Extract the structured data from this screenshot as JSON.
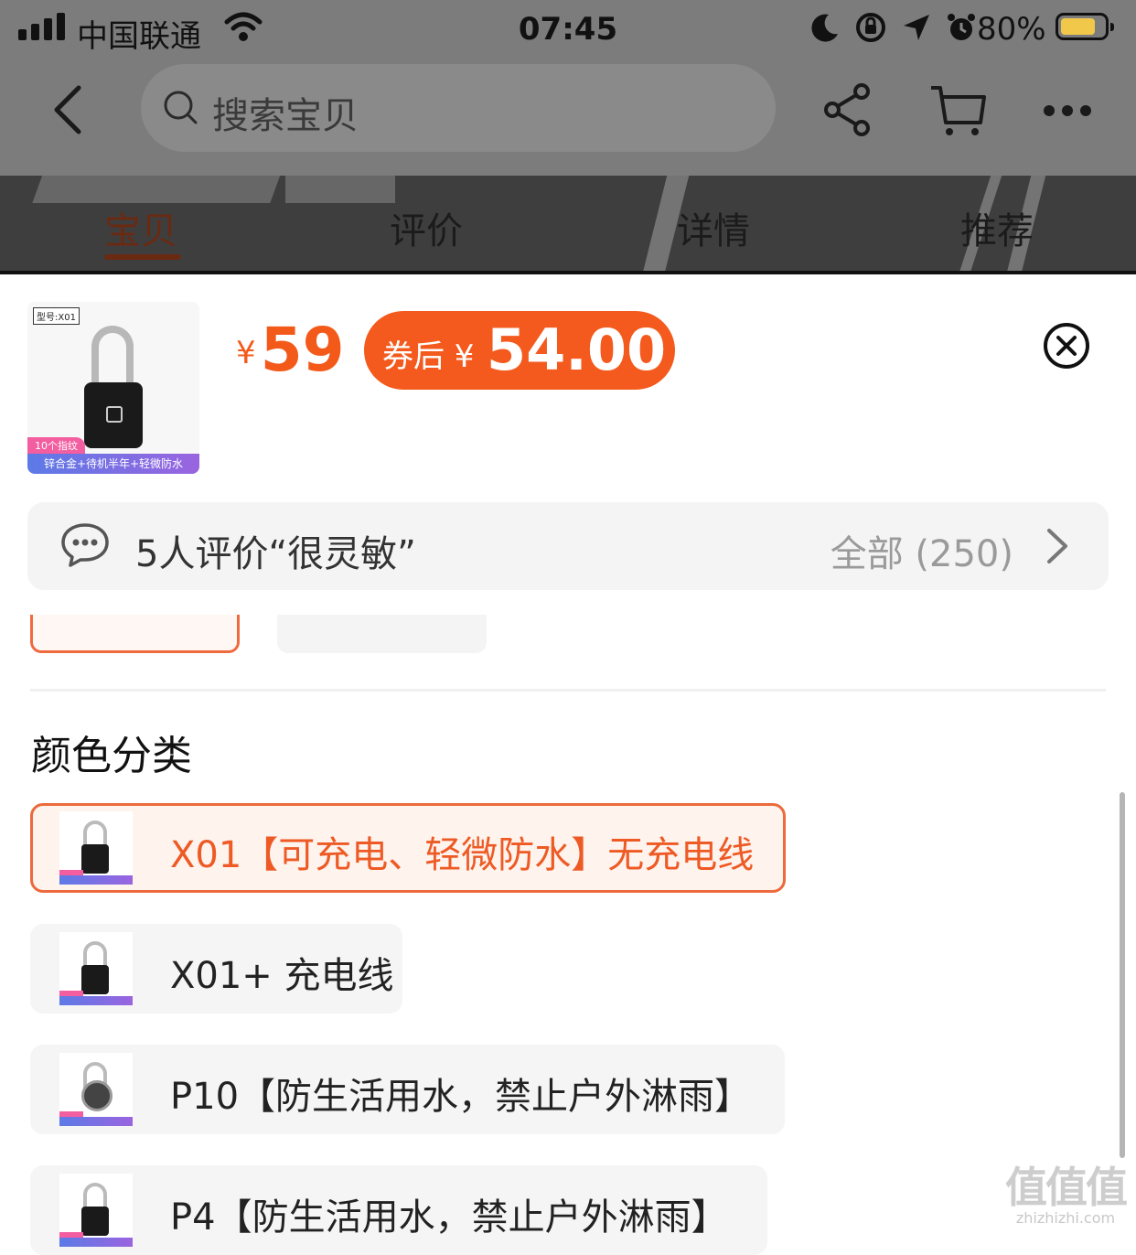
{
  "status_bar": {
    "carrier": "中国联通",
    "time": "07:45",
    "battery_percent": "80%",
    "battery_level": 0.8
  },
  "nav": {
    "search_placeholder": "搜索宝贝"
  },
  "tabs": [
    {
      "label": "宝贝",
      "active": true
    },
    {
      "label": "评价",
      "active": false
    },
    {
      "label": "详情",
      "active": false
    },
    {
      "label": "推荐",
      "active": false
    }
  ],
  "product": {
    "image_text": {
      "model_tag": "型号:X01",
      "fingerprint_tag": "10个指纹",
      "footer": "锌合金+待机半年+轻微防水"
    },
    "price_symbol": "¥",
    "price": "59",
    "coupon_label": "券后 ¥",
    "coupon_price": "54.00"
  },
  "review_summary": {
    "text": "5人评价“很灵敏”",
    "all_label": "全部 (250)"
  },
  "section": {
    "title": "颜色分类"
  },
  "options": [
    {
      "label": "X01【可充电、轻微防水】无充电线",
      "selected": true
    },
    {
      "label": "X01+ 充电线",
      "selected": false
    },
    {
      "label": "P10【防生活用水，禁止户外淋雨】",
      "selected": false
    },
    {
      "label": "P4【防生活用水，禁止户外淋雨】",
      "selected": false
    }
  ],
  "watermark": {
    "big": "值值值",
    "small": "zhizhizhi.com"
  },
  "colors": {
    "accent": "#f45a1e",
    "overlay": "#7c7c7c",
    "option_bg": "#f5f5f5"
  }
}
